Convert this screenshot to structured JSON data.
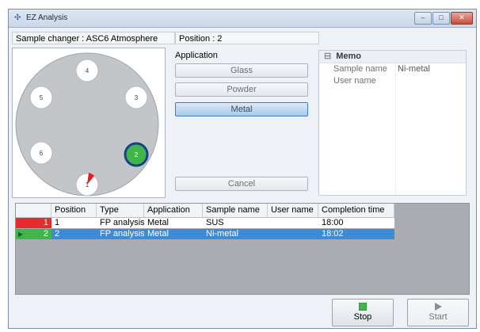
{
  "window": {
    "title": "EZ Analysis",
    "controls": {
      "minimize": "–",
      "maximize": "□",
      "close": "✕"
    }
  },
  "infobar": {
    "sample_changer": "Sample changer : ASC6  Atmosphere",
    "position": "Position : 2"
  },
  "carousel": {
    "positions": [
      {
        "label": "4",
        "state": "empty"
      },
      {
        "label": "5",
        "state": "empty"
      },
      {
        "label": "3",
        "state": "empty"
      },
      {
        "label": "6",
        "state": "empty"
      },
      {
        "label": "2",
        "state": "selected"
      },
      {
        "label": "1",
        "state": "measuring"
      }
    ],
    "colors": {
      "selected_fill": "#3fb54a",
      "selected_ring": "#1c3f8c",
      "marker": "#e02020"
    }
  },
  "application": {
    "label": "Application",
    "options": [
      "Glass",
      "Powder",
      "Metal"
    ],
    "selected": "Metal",
    "cancel": "Cancel"
  },
  "memo": {
    "header": "Memo",
    "rows": [
      {
        "key": "Sample name",
        "value": "Ni-metal"
      },
      {
        "key": "User name",
        "value": ""
      }
    ]
  },
  "table": {
    "columns": [
      "Position",
      "Type",
      "Application",
      "Sample name",
      "User name",
      "Completion time"
    ],
    "rows": [
      {
        "num": "1",
        "cells": [
          "1",
          "FP analysis",
          "Metal",
          "SUS",
          "",
          "18:00"
        ],
        "marker_color": "#e52b2b",
        "selected": false
      },
      {
        "num": "2",
        "cells": [
          "2",
          "FP analysis",
          "Metal",
          "Ni-metal",
          "",
          "18:02"
        ],
        "marker_color": "#3fb54a",
        "selected": true
      }
    ]
  },
  "footer": {
    "stop": "Stop",
    "start": "Start"
  }
}
